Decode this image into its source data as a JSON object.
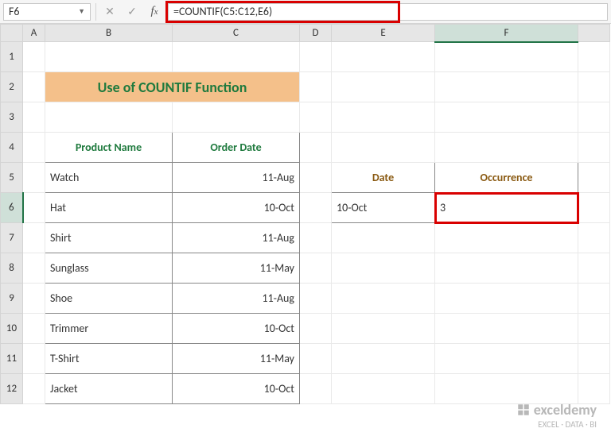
{
  "namebox": {
    "value": "F6"
  },
  "formula": {
    "text": "=COUNTIF(C5:C12,E6)"
  },
  "columns": [
    "A",
    "B",
    "C",
    "D",
    "E",
    "F"
  ],
  "rows": [
    "1",
    "2",
    "3",
    "4",
    "5",
    "6",
    "7",
    "8",
    "9",
    "10",
    "11",
    "12"
  ],
  "title": "Use of COUNTIF Function",
  "table": {
    "headers": {
      "b": "Product Name",
      "c": "Order Date"
    },
    "rows": [
      {
        "b": "Watch",
        "c": "11-Aug"
      },
      {
        "b": "Hat",
        "c": "10-Oct"
      },
      {
        "b": "Shirt",
        "c": "11-Aug"
      },
      {
        "b": "Sunglass",
        "c": "11-May"
      },
      {
        "b": "Shoe",
        "c": "11-Aug"
      },
      {
        "b": "Trimmer",
        "c": "10-Oct"
      },
      {
        "b": "T-Shirt",
        "c": "11-May"
      },
      {
        "b": "Jacket",
        "c": "10-Oct"
      }
    ]
  },
  "side": {
    "headers": {
      "e": "Date",
      "f": "Occurrence"
    },
    "e6": "10-Oct",
    "f6": "3"
  },
  "watermark": {
    "brand": "exceldemy",
    "tag": "EXCEL · DATA · BI"
  },
  "colors": {
    "accent_green": "#1f7a3e",
    "header_fill": "#f4c08a",
    "highlight_red": "#d90000"
  }
}
